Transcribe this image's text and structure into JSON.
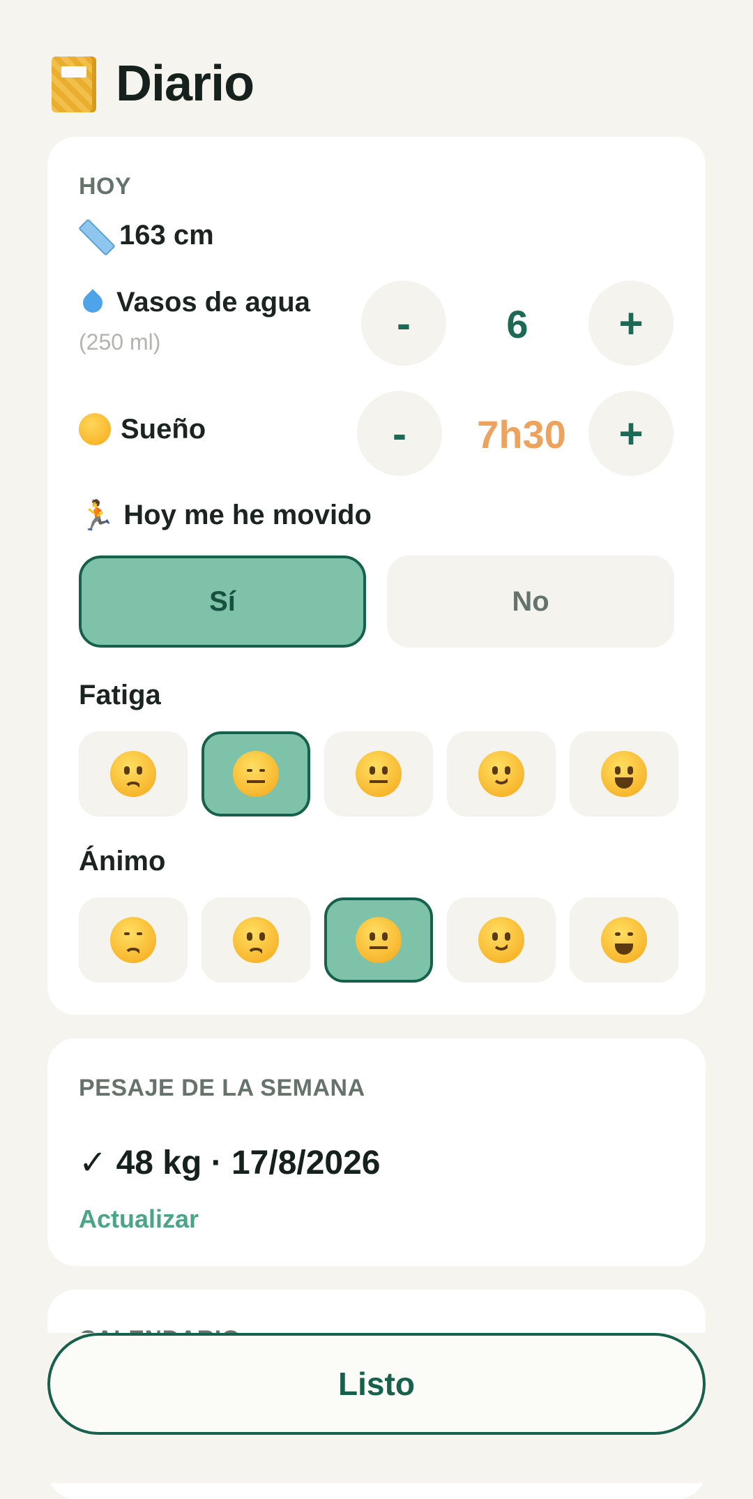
{
  "header": {
    "title": "Diario",
    "icon": "notebook-icon"
  },
  "today": {
    "section_label": "HOY",
    "height": {
      "icon": "ruler-icon",
      "value": "163 cm"
    },
    "water": {
      "icon": "droplet-icon",
      "label": "Vasos de agua",
      "sublabel": "(250 ml)",
      "minus": "-",
      "value": "6",
      "plus": "+"
    },
    "sleep": {
      "icon": "sleeping-face-icon",
      "label": "Sueño",
      "minus": "-",
      "value": "7h30",
      "plus": "+",
      "value_color": "#eda35e"
    },
    "moved": {
      "icon": "runner-icon",
      "label": "Hoy me he movido",
      "yes": "Sí",
      "no": "No",
      "selected": "yes"
    },
    "fatigue": {
      "label": "Fatiga",
      "options": [
        "weary-face",
        "sleepy-face",
        "neutral-face",
        "slightly-smiling-face",
        "grinning-face"
      ],
      "selected_index": 1
    },
    "mood": {
      "label": "Ánimo",
      "options": [
        "disappointed-face",
        "slightly-frowning-face",
        "neutral-face",
        "slightly-smiling-face",
        "grinning-smiling-eyes-face"
      ],
      "selected_index": 2
    }
  },
  "weighing": {
    "section_label": "PESAJE DE LA SEMANA",
    "check": "✓",
    "value": "48 kg · 17/8/2026",
    "update_link": "Actualizar"
  },
  "calendar": {
    "section_label": "CALENDARIO"
  },
  "footer": {
    "done_label": "Listo"
  },
  "colors": {
    "accent": "#17604b",
    "selected_bg": "#7dc2a9",
    "link": "#4aa587",
    "background": "#f5f4ef"
  }
}
